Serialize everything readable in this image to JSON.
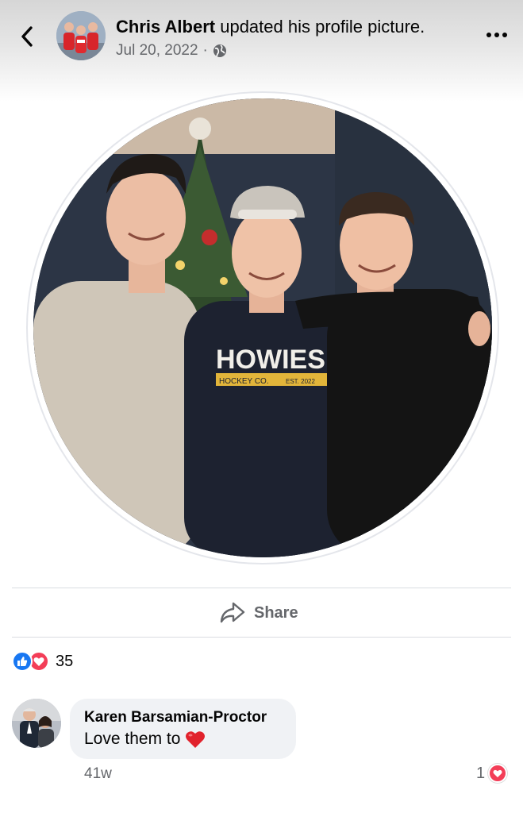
{
  "header": {
    "author_name": "Chris Albert",
    "action_text": "updated his profile picture.",
    "date": "Jul 20, 2022",
    "separator": "·",
    "privacy_icon": "globe-icon",
    "back_icon": "chevron-left-icon",
    "more_icon": "more-horizontal-icon"
  },
  "photo": {
    "hoodie_text": "HOWIES",
    "hoodie_subtext": "HOCKEY CO.",
    "hoodie_badge": "EST. 2022"
  },
  "actions": {
    "share_label": "Share",
    "share_icon": "share-arrow-icon"
  },
  "reactions": {
    "count": "35",
    "icons": [
      "like-icon",
      "love-icon"
    ]
  },
  "comment": {
    "author": "Karen Barsamian-Proctor",
    "text": "Love them to",
    "emoji": "❤️",
    "time": "41w",
    "reaction_count": "1"
  },
  "colors": {
    "like": "#1877f2",
    "love": "#f33e58",
    "secondary_text": "#65676b",
    "bubble": "#f0f2f5"
  }
}
